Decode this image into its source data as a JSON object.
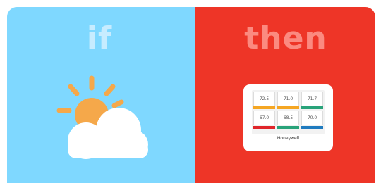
{
  "if_panel": {
    "label": "if",
    "icon": "partly-sunny-weather-icon",
    "color": "#7fd8ff"
  },
  "then_panel": {
    "label": "then",
    "icon": "thermostat-icon",
    "color": "#ee3527",
    "thermostat": {
      "brand": "Honeywell",
      "tiles": [
        {
          "value": "72.5",
          "bar_color": "#f5a623"
        },
        {
          "value": "71.0",
          "bar_color": "#f5a623"
        },
        {
          "value": "71.7",
          "bar_color": "#29a37a"
        },
        {
          "value": "67.0",
          "bar_color": "#e0262a"
        },
        {
          "value": "68.5",
          "bar_color": "#29a37a"
        },
        {
          "value": "70.0",
          "bar_color": "#1f7bbf"
        }
      ]
    }
  }
}
